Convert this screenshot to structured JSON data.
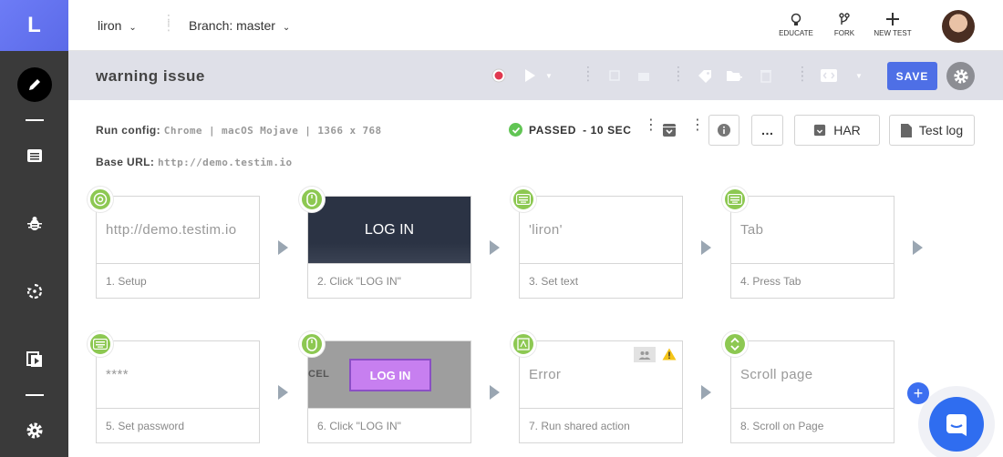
{
  "app": {
    "logo": "L"
  },
  "topbar": {
    "user": "liron",
    "branch": "Branch: master",
    "actions": {
      "educate": "EDUCATE",
      "fork": "FORK",
      "new_test": "NEW TEST"
    }
  },
  "test": {
    "name": "warning issue",
    "save_label": "SAVE"
  },
  "run": {
    "config_label": "Run config:",
    "config_value": "Chrome | macOS Mojave | 1366 x 768",
    "base_url_label": "Base URL:",
    "base_url_value": "http://demo.testim.io",
    "status": "PASSED",
    "duration": "- 10 SEC",
    "more": "…",
    "har_label": "HAR",
    "test_log_label": "Test log"
  },
  "steps": [
    {
      "preview": "http://demo.testim.io",
      "label": "1. Setup",
      "icon": "chrome-icon"
    },
    {
      "preview": "LOG IN",
      "label": "2. Click \"LOG IN\"",
      "icon": "mouse-icon"
    },
    {
      "preview": "'liron'",
      "label": "3. Set text",
      "icon": "keyboard-icon"
    },
    {
      "preview": "Tab",
      "label": "4. Press Tab",
      "icon": "keyboard-icon"
    },
    {
      "preview": "****",
      "label": "5. Set password",
      "icon": "keyboard-icon"
    },
    {
      "preview": "LOG IN",
      "preview_extra": "CEL",
      "label": "6. Click \"LOG IN\"",
      "icon": "mouse-icon"
    },
    {
      "preview": "Error",
      "label": "7. Run shared action",
      "icon": "shared-action-icon"
    },
    {
      "preview": "Scroll page",
      "label": "8. Scroll on Page",
      "icon": "scroll-icon"
    }
  ],
  "colors": {
    "accent": "#4e6fe6",
    "badge": "#8dc852",
    "passed": "#61c554",
    "record": "#e0384f",
    "warning": "#f5c518"
  }
}
